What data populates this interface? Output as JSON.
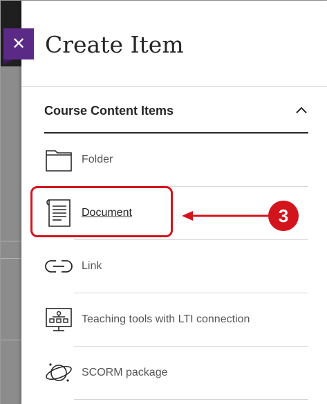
{
  "panel": {
    "close_icon": "close-icon",
    "title": "Create Item"
  },
  "section": {
    "title": "Course Content Items",
    "expanded": true,
    "chevron_icon": "chevron-up-icon"
  },
  "items": [
    {
      "label": "Folder",
      "icon": "folder-icon"
    },
    {
      "label": "Document",
      "icon": "document-icon",
      "selected": true
    },
    {
      "label": "Link",
      "icon": "link-icon"
    },
    {
      "label": "Teaching tools with LTI connection",
      "icon": "lti-tools-icon"
    },
    {
      "label": "SCORM package",
      "icon": "scorm-icon"
    }
  ],
  "annotation": {
    "step_number": "3",
    "color": "#d4141c"
  },
  "colors": {
    "accent": "#5b2a86",
    "text": "#262626",
    "muted": "#555555"
  }
}
